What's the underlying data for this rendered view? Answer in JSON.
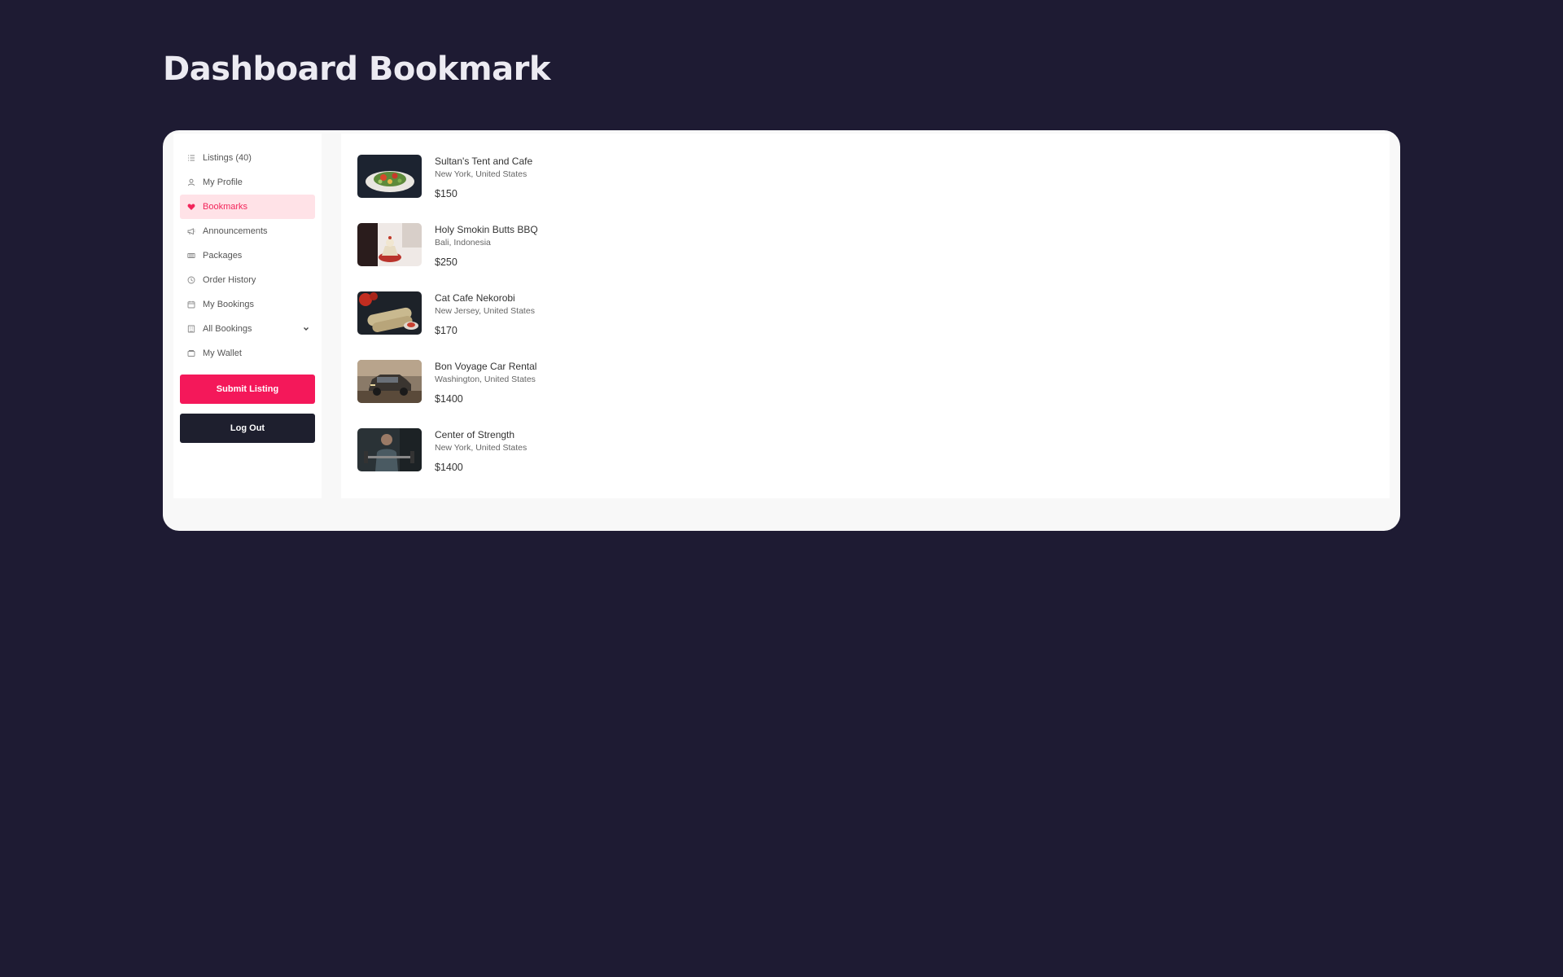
{
  "header": {
    "title": "Dashboard Bookmark"
  },
  "sidebar": {
    "items": [
      {
        "label": "Listings (40)",
        "icon": "list-icon",
        "active": false
      },
      {
        "label": "My Profile",
        "icon": "user-icon",
        "active": false
      },
      {
        "label": "Bookmarks",
        "icon": "heart-icon",
        "active": true
      },
      {
        "label": "Announcements",
        "icon": "megaphone-icon",
        "active": false
      },
      {
        "label": "Packages",
        "icon": "package-icon",
        "active": false
      },
      {
        "label": "Order History",
        "icon": "clock-icon",
        "active": false
      },
      {
        "label": "My Bookings",
        "icon": "calendar-icon",
        "active": false
      },
      {
        "label": "All Bookings",
        "icon": "building-icon",
        "active": false,
        "has_dropdown": true
      },
      {
        "label": "My Wallet",
        "icon": "wallet-icon",
        "active": false
      }
    ],
    "submit_label": "Submit Listing",
    "logout_label": "Log Out"
  },
  "bookmarks": [
    {
      "title": "Sultan's Tent and Cafe",
      "location": "New York, United States",
      "price": "$150",
      "image": "salad-plate-image"
    },
    {
      "title": "Holy Smokin Butts BBQ",
      "location": "Bali, Indonesia",
      "price": "$250",
      "image": "dessert-image"
    },
    {
      "title": "Cat Cafe Nekorobi",
      "location": "New Jersey, United States",
      "price": "$170",
      "image": "wraps-image"
    },
    {
      "title": "Bon Voyage Car Rental",
      "location": "Washington, United States",
      "price": "$1400",
      "image": "suv-car-image"
    },
    {
      "title": "Center of Strength",
      "location": "New York, United States",
      "price": "$1400",
      "image": "gym-man-image"
    }
  ],
  "colors": {
    "background": "#1e1b33",
    "accent": "#f4185a",
    "active_bg": "#ffe2e7",
    "logout": "#1e1f2e"
  }
}
